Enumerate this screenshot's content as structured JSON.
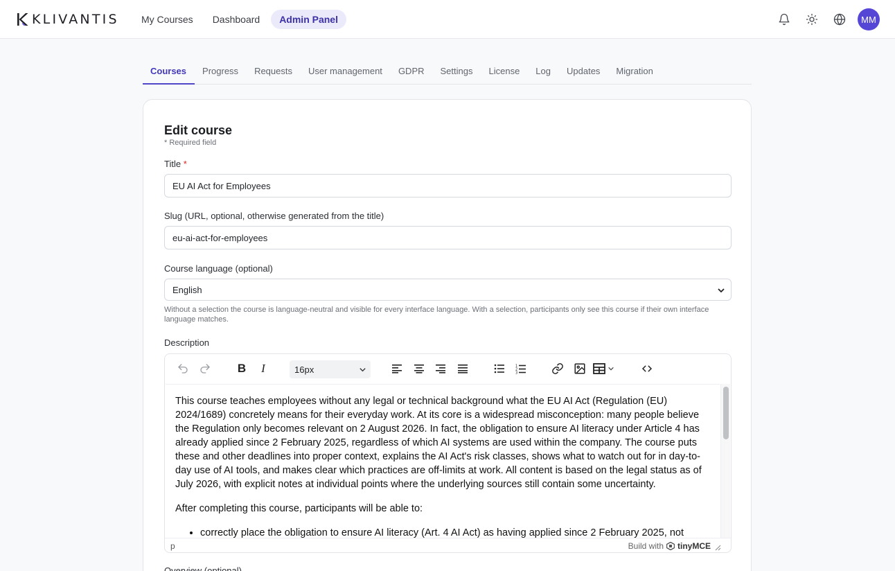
{
  "app": {
    "logo_text": "KLIVANTIS"
  },
  "nav": {
    "items": [
      {
        "label": "My Courses"
      },
      {
        "label": "Dashboard"
      },
      {
        "label": "Admin Panel"
      }
    ],
    "avatar_initials": "MM"
  },
  "tabs": [
    {
      "label": "Courses"
    },
    {
      "label": "Progress"
    },
    {
      "label": "Requests"
    },
    {
      "label": "User management"
    },
    {
      "label": "GDPR"
    },
    {
      "label": "Settings"
    },
    {
      "label": "License"
    },
    {
      "label": "Log"
    },
    {
      "label": "Updates"
    },
    {
      "label": "Migration"
    }
  ],
  "form": {
    "heading": "Edit course",
    "required_note": "* Required field",
    "title": {
      "label": "Title",
      "required_mark": "*",
      "value": "EU AI Act for Employees"
    },
    "slug": {
      "label": "Slug (URL, optional, otherwise generated from the title)",
      "value": "eu-ai-act-for-employees"
    },
    "language": {
      "label": "Course language (optional)",
      "value": "English",
      "help": "Without a selection the course is language-neutral and visible for every interface language. With a selection, participants only see this course if their own interface language matches."
    },
    "description": {
      "label": "Description",
      "font_size": "16px",
      "paragraph1": "This course teaches employees without any legal or technical background what the EU AI Act (Regulation (EU) 2024/1689) concretely means for their everyday work. At its core is a widespread misconception: many people believe the Regulation only becomes relevant on 2 August 2026. In fact, the obligation to ensure AI literacy under Article 4 has already applied since 2 February 2025, regardless of which AI systems are used within the company. The course puts these and other deadlines into proper context, explains the AI Act's risk classes, shows what to watch out for in day-to-day use of AI tools, and makes clear which practices are off-limits at work. All content is based on the legal status as of July 2026, with explicit notes at individual points where the underlying sources still contain some uncertainty.",
      "paragraph2": "After completing this course, participants will be able to:",
      "bullet1": "correctly place the obligation to ensure AI literacy (Art. 4 AI Act) as having applied since 2 February 2025, not",
      "status_path": "p",
      "build_with": "Build with",
      "brand": "tinyMCE"
    },
    "next_label": "Overview (optional)"
  },
  "colors": {
    "accent": "#5546d6",
    "tab_active": "#4338b8",
    "required": "#dd2222"
  }
}
